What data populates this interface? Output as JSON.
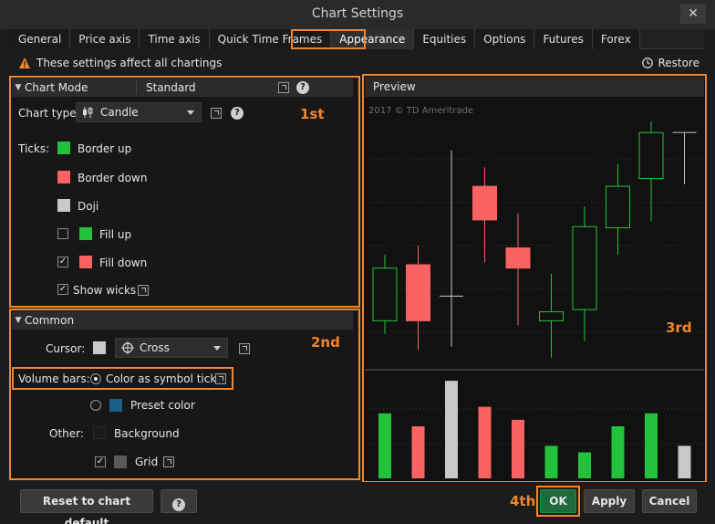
{
  "window": {
    "title": "Chart Settings",
    "close_label": "✕"
  },
  "tabs": [
    {
      "label": "General"
    },
    {
      "label": "Price axis"
    },
    {
      "label": "Time axis"
    },
    {
      "label": "Quick Time Frames"
    },
    {
      "label": "Appearance",
      "active": true
    },
    {
      "label": "Equities"
    },
    {
      "label": "Options"
    },
    {
      "label": "Futures"
    },
    {
      "label": "Forex"
    }
  ],
  "infobar": {
    "message": "These settings affect all chartings",
    "restore_label": "Restore"
  },
  "chart_mode": {
    "header": "Chart Mode",
    "mode_value": "Standard",
    "chart_type_label": "Chart type:",
    "chart_type_value": "Candle",
    "ticks_label": "Ticks:",
    "border_up": "Border up",
    "border_down": "Border down",
    "doji": "Doji",
    "fill_up": "Fill up",
    "fill_down": "Fill down",
    "show_wicks": "Show wicks",
    "fill_up_checked": false,
    "fill_down_checked": true,
    "show_wicks_checked": true,
    "help": "?"
  },
  "common": {
    "header": "Common",
    "cursor_label": "Cursor:",
    "cursor_value": "Cross",
    "volume_label": "Volume bars:",
    "volume_opt1": "Color as symbol ticks",
    "volume_opt2": "Preset color",
    "other_label": "Other:",
    "background": "Background",
    "grid": "Grid",
    "grid_checked": true
  },
  "annotations": {
    "first": "1st",
    "second": "2nd",
    "third": "3rd",
    "fourth": "4th"
  },
  "preview": {
    "header": "Preview",
    "watermark": "2017 © TD Ameritrade"
  },
  "colors": {
    "up": "#22c23c",
    "down": "#fb6262",
    "doji": "#c8c8c8",
    "preset": "#1b5f86",
    "background": "#1a1a1a",
    "grid": "#5a5a5a",
    "accent": "#f0862c"
  },
  "buttons": {
    "reset": "Reset to chart default",
    "help": "?",
    "ok": "OK",
    "apply": "Apply",
    "cancel": "Cancel"
  },
  "candles": [
    {
      "kind": "up",
      "open": 38,
      "close": 85,
      "high": 97,
      "low": 26
    },
    {
      "kind": "down",
      "open": 88,
      "close": 38,
      "high": 105,
      "low": 12
    },
    {
      "kind": "doji",
      "open": 60,
      "close": 60,
      "high": 190,
      "low": 15
    },
    {
      "kind": "down",
      "open": 158,
      "close": 128,
      "high": 175,
      "low": 90
    },
    {
      "kind": "down",
      "open": 103,
      "close": 85,
      "high": 134,
      "low": 34
    },
    {
      "kind": "up",
      "open": 38,
      "close": 46,
      "high": 80,
      "low": 5
    },
    {
      "kind": "up",
      "open": 48,
      "close": 122,
      "high": 140,
      "low": 20
    },
    {
      "kind": "up",
      "open": 121,
      "close": 158,
      "high": 178,
      "low": 97
    },
    {
      "kind": "up",
      "open": 165,
      "close": 206,
      "high": 216,
      "low": 127
    },
    {
      "kind": "doji",
      "open": 206,
      "close": 206,
      "high": 206,
      "low": 160
    }
  ],
  "volumes": [
    {
      "kind": "up",
      "value": 50
    },
    {
      "kind": "down",
      "value": 40
    },
    {
      "kind": "doji",
      "value": 75
    },
    {
      "kind": "down",
      "value": 55
    },
    {
      "kind": "down",
      "value": 45
    },
    {
      "kind": "up",
      "value": 25
    },
    {
      "kind": "up",
      "value": 20
    },
    {
      "kind": "up",
      "value": 40
    },
    {
      "kind": "up",
      "value": 50
    },
    {
      "kind": "doji",
      "value": 25
    }
  ]
}
